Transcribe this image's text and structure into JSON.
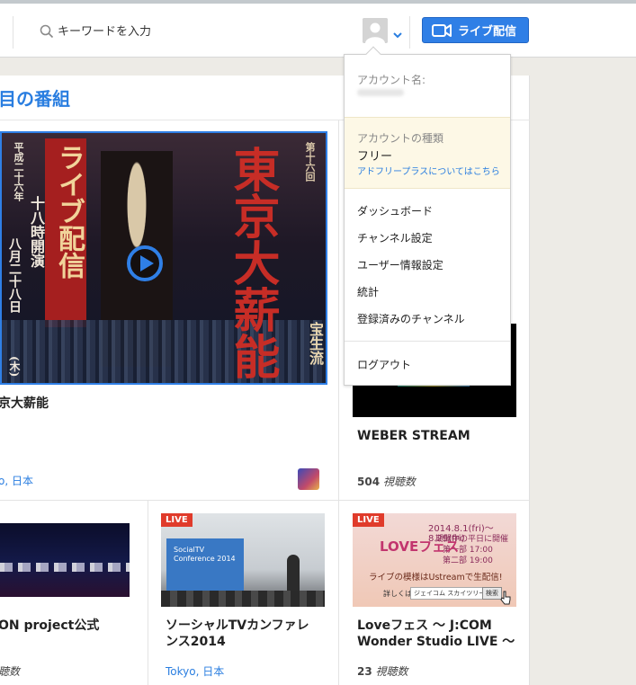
{
  "header": {
    "search_placeholder": "キーワードを入力",
    "live_button": "ライブ配信"
  },
  "section": {
    "title": "目の番組"
  },
  "featured": {
    "title": "京大薪能",
    "location": "o, 日本",
    "art_text": {
      "main": "東京大薪能",
      "sub": "ライブ配信",
      "date": "八月二十八日",
      "weekday": "(木)",
      "time": "十八時開演",
      "era": "平成二十六年",
      "edition": "第十六回",
      "school": "宝生流"
    }
  },
  "right_card": {
    "title": "WEBER STREAM",
    "views_count": "504",
    "views_unit": "視聴数"
  },
  "bottom_cards": [
    {
      "title": "ON project公式",
      "views_unit": "聴数"
    },
    {
      "badge": "LIVE",
      "title": "ソーシャルTVカンファレンス2014",
      "location": "Tokyo, 日本",
      "thumb_text": "SocialTV Conference 2014"
    },
    {
      "badge": "LIVE",
      "title": "Loveフェス 〜 J:COM Wonder Studio LIVE 〜",
      "views_count": "23",
      "views_unit": "視聴数",
      "thumb_text": {
        "dates": "2014.8.1(fri)〜8.29(fri)",
        "period": "期間中の平日に開催",
        "part1": "第一部 17:00",
        "part2": "第二部 19:00",
        "logo": "LOVEフェス",
        "cta": "ライブの模様はUstreamで生配信!",
        "search_pre": "詳しくは",
        "search_query": "ジェイコム スカイツリー",
        "search_btn": "検索"
      }
    }
  ],
  "dropdown": {
    "account_name_label": "アカウント名:",
    "account_type_label": "アカウントの種類",
    "account_type_value": "フリー",
    "upgrade_link": "アドフリープラスについてはこちら",
    "menu": [
      "ダッシュボード",
      "チャンネル設定",
      "ユーザー情報設定",
      "統計",
      "登録済みのチャンネル"
    ],
    "logout": "ログアウト"
  },
  "colors": {
    "accent": "#2f7fe6",
    "live_badge": "#e03b2b",
    "plan_bg": "#fdf8e6"
  }
}
